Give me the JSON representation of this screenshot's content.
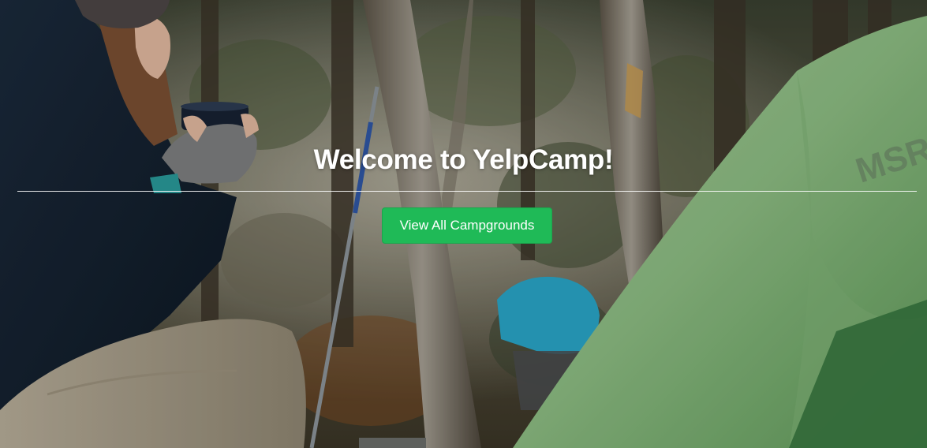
{
  "landing": {
    "title": "Welcome to YelpCamp!",
    "cta_label": "View All Campgrounds",
    "background": "camping-photo-woman-with-mug-and-green-tent"
  },
  "colors": {
    "button_bg": "#1fba57",
    "title_text": "#ffffff",
    "tent_green": "#8fbf86"
  }
}
